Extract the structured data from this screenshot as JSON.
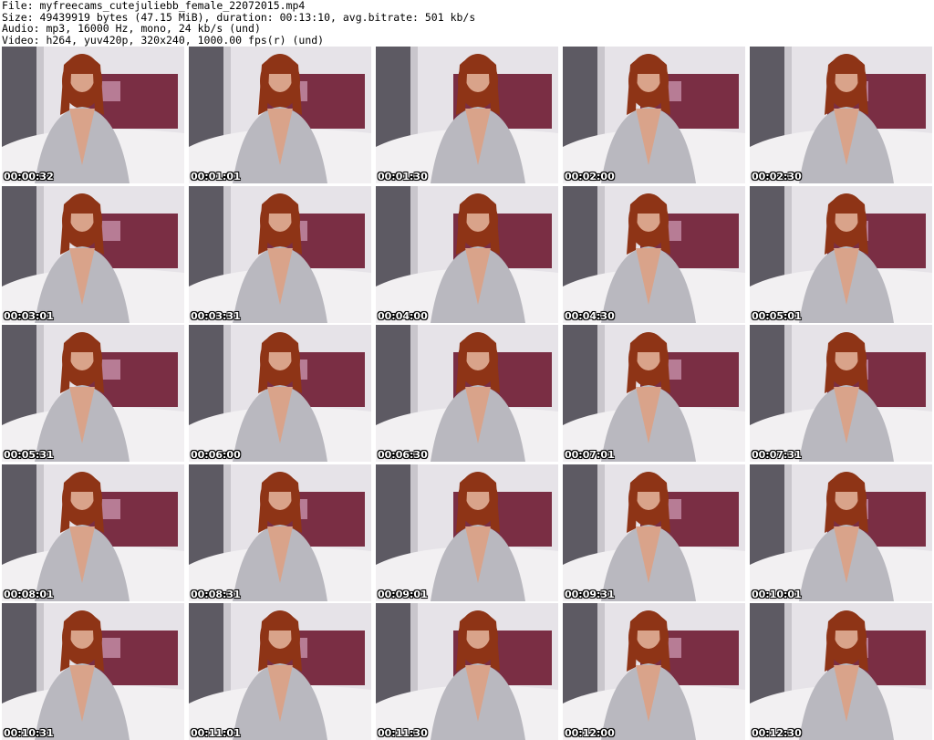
{
  "header": {
    "file_line": "File: myfreecams_cutejuliebb_female_22072015.mp4",
    "size_line": "Size: 49439919 bytes (47.15 MiB), duration: 00:13:10, avg.bitrate: 501 kb/s",
    "audio_line": "Audio: mp3, 16000 Hz, mono, 24 kb/s (und)",
    "video_line": "Video: h264, yuv420p, 320x240, 1000.00 fps(r) (und)"
  },
  "colors": {
    "headboard": "#7a2e44",
    "wall": "#e6e3e8",
    "curtain": "#5d5a63",
    "bed": "#f2f0f2",
    "robe": "#b9b8bf",
    "hair": "#8e3416",
    "skin": "#d9a38a"
  },
  "thumbnails": [
    {
      "time": "00:00:32"
    },
    {
      "time": "00:01:01"
    },
    {
      "time": "00:01:30"
    },
    {
      "time": "00:02:00"
    },
    {
      "time": "00:02:30"
    },
    {
      "time": "00:03:01"
    },
    {
      "time": "00:03:31"
    },
    {
      "time": "00:04:00"
    },
    {
      "time": "00:04:30"
    },
    {
      "time": "00:05:01"
    },
    {
      "time": "00:05:31"
    },
    {
      "time": "00:06:00"
    },
    {
      "time": "00:06:30"
    },
    {
      "time": "00:07:01"
    },
    {
      "time": "00:07:31"
    },
    {
      "time": "00:08:01"
    },
    {
      "time": "00:08:31"
    },
    {
      "time": "00:09:01"
    },
    {
      "time": "00:09:31"
    },
    {
      "time": "00:10:01"
    },
    {
      "time": "00:10:31"
    },
    {
      "time": "00:11:01"
    },
    {
      "time": "00:11:30"
    },
    {
      "time": "00:12:00"
    },
    {
      "time": "00:12:30"
    }
  ]
}
